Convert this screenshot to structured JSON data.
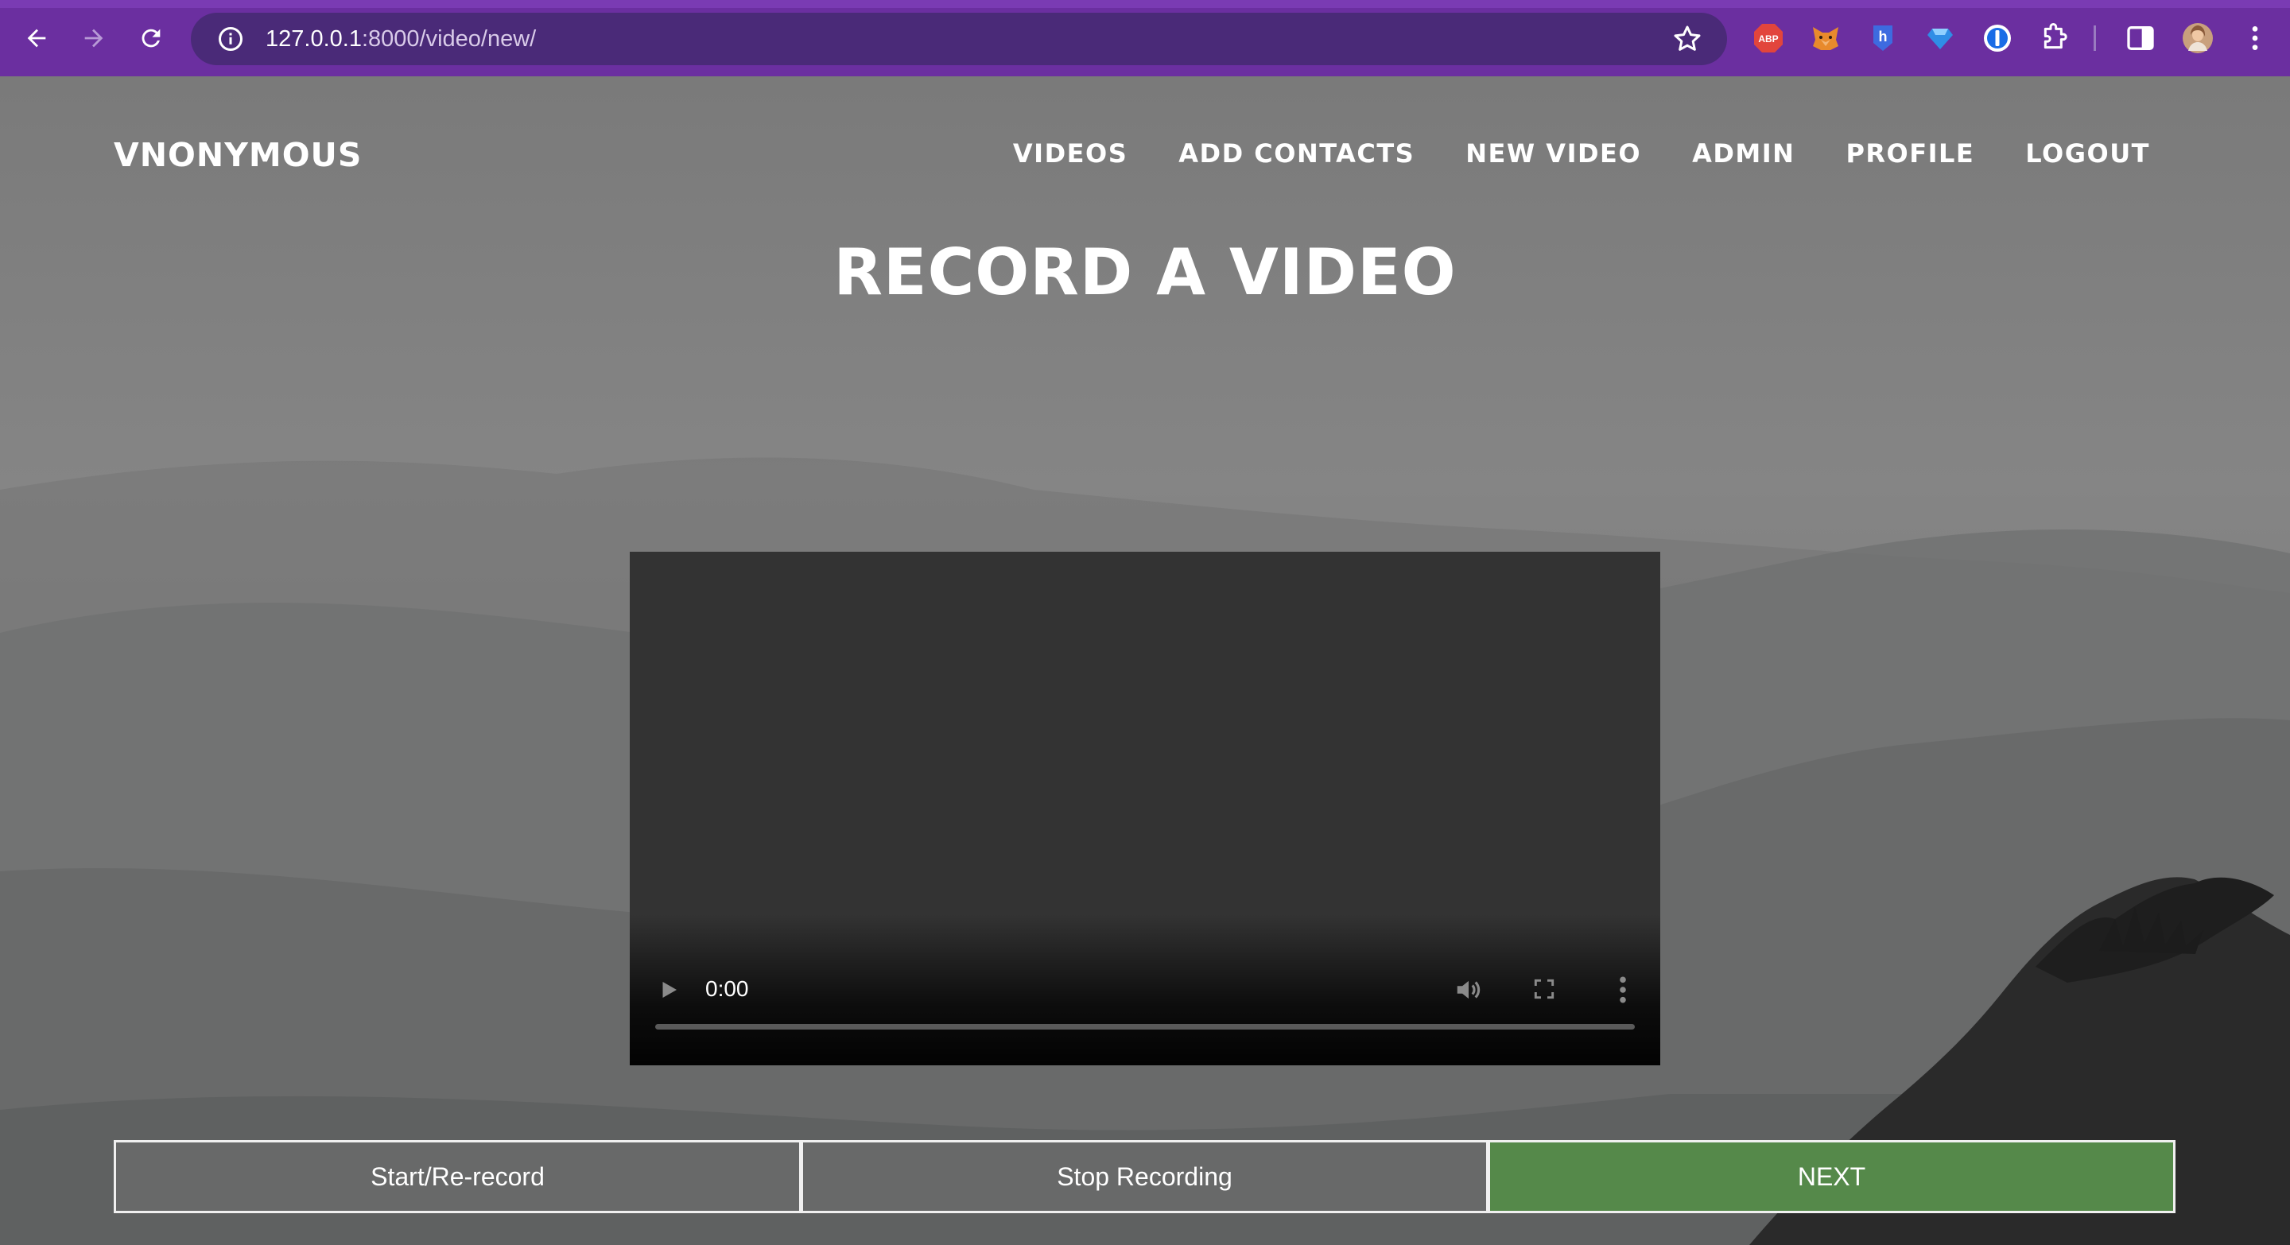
{
  "browser": {
    "url_host": "127.0.0.1",
    "url_path": ":8000/video/new/",
    "toolbar_icons": [
      "back-icon",
      "forward-icon",
      "reload-icon",
      "site-info-icon",
      "bookmark-star-icon"
    ],
    "extensions": [
      "adblock-plus-icon",
      "metamask-fox-icon",
      "honey-icon",
      "gem-extension-icon",
      "onepassword-icon",
      "extensions-puzzle-icon",
      "side-panel-icon",
      "profile-avatar-icon",
      "chrome-menu-icon"
    ],
    "extension_label_abp": "ABP"
  },
  "header": {
    "brand": "VNONYMOUS",
    "nav": [
      "VIDEOS",
      "ADD CONTACTS",
      "NEW VIDEO",
      "ADMIN",
      "PROFILE",
      "LOGOUT"
    ]
  },
  "main": {
    "title": "RECORD A VIDEO",
    "video": {
      "current_time": "0:00",
      "progress": 0
    },
    "buttons": {
      "start": "Start/Re-record",
      "stop": "Stop Recording",
      "next": "NEXT"
    }
  },
  "colors": {
    "chrome_bg": "#6b2fa0",
    "omnibox_bg": "#4a2a78",
    "next_button": "#55894a",
    "video_bg": "#333333"
  }
}
